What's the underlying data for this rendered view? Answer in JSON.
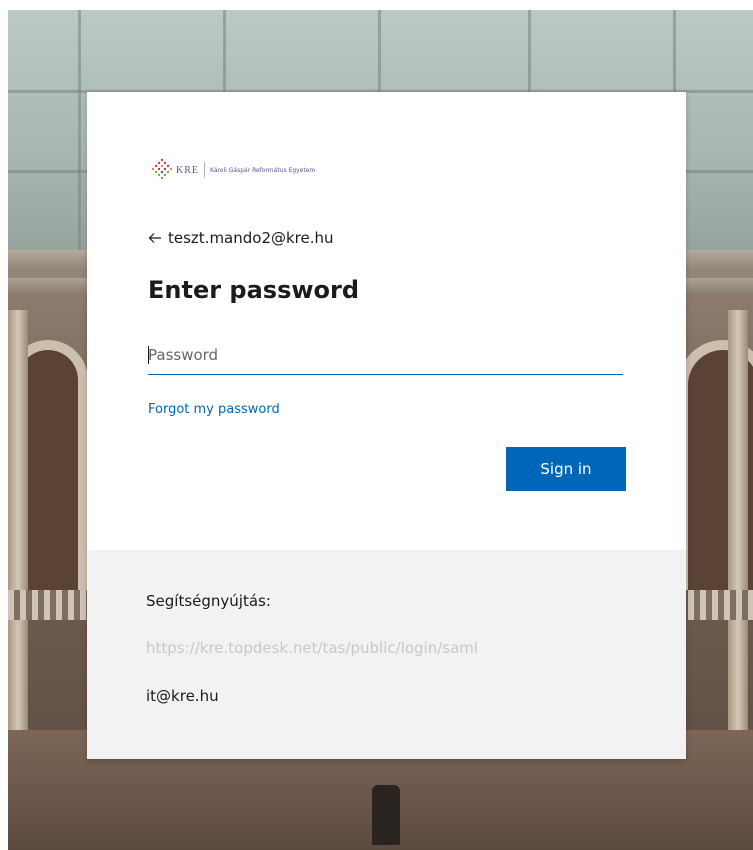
{
  "logo": {
    "abbr": "KRE",
    "name": "Károli Gáspár Református Egyetem",
    "accent_color": "#6a4f8a"
  },
  "account": {
    "back_icon": "arrow-left-icon",
    "email": "teszt.mando2@kre.hu"
  },
  "form": {
    "title": "Enter password",
    "password_placeholder": "Password",
    "password_value": "",
    "forgot_link": "Forgot my password",
    "signin_label": "Sign in",
    "primary_color": "#0067b8"
  },
  "help": {
    "label": "Segítségnyújtás:",
    "link": "https://kre.topdesk.net/tas/public/login/saml",
    "email": "it@kre.hu"
  }
}
